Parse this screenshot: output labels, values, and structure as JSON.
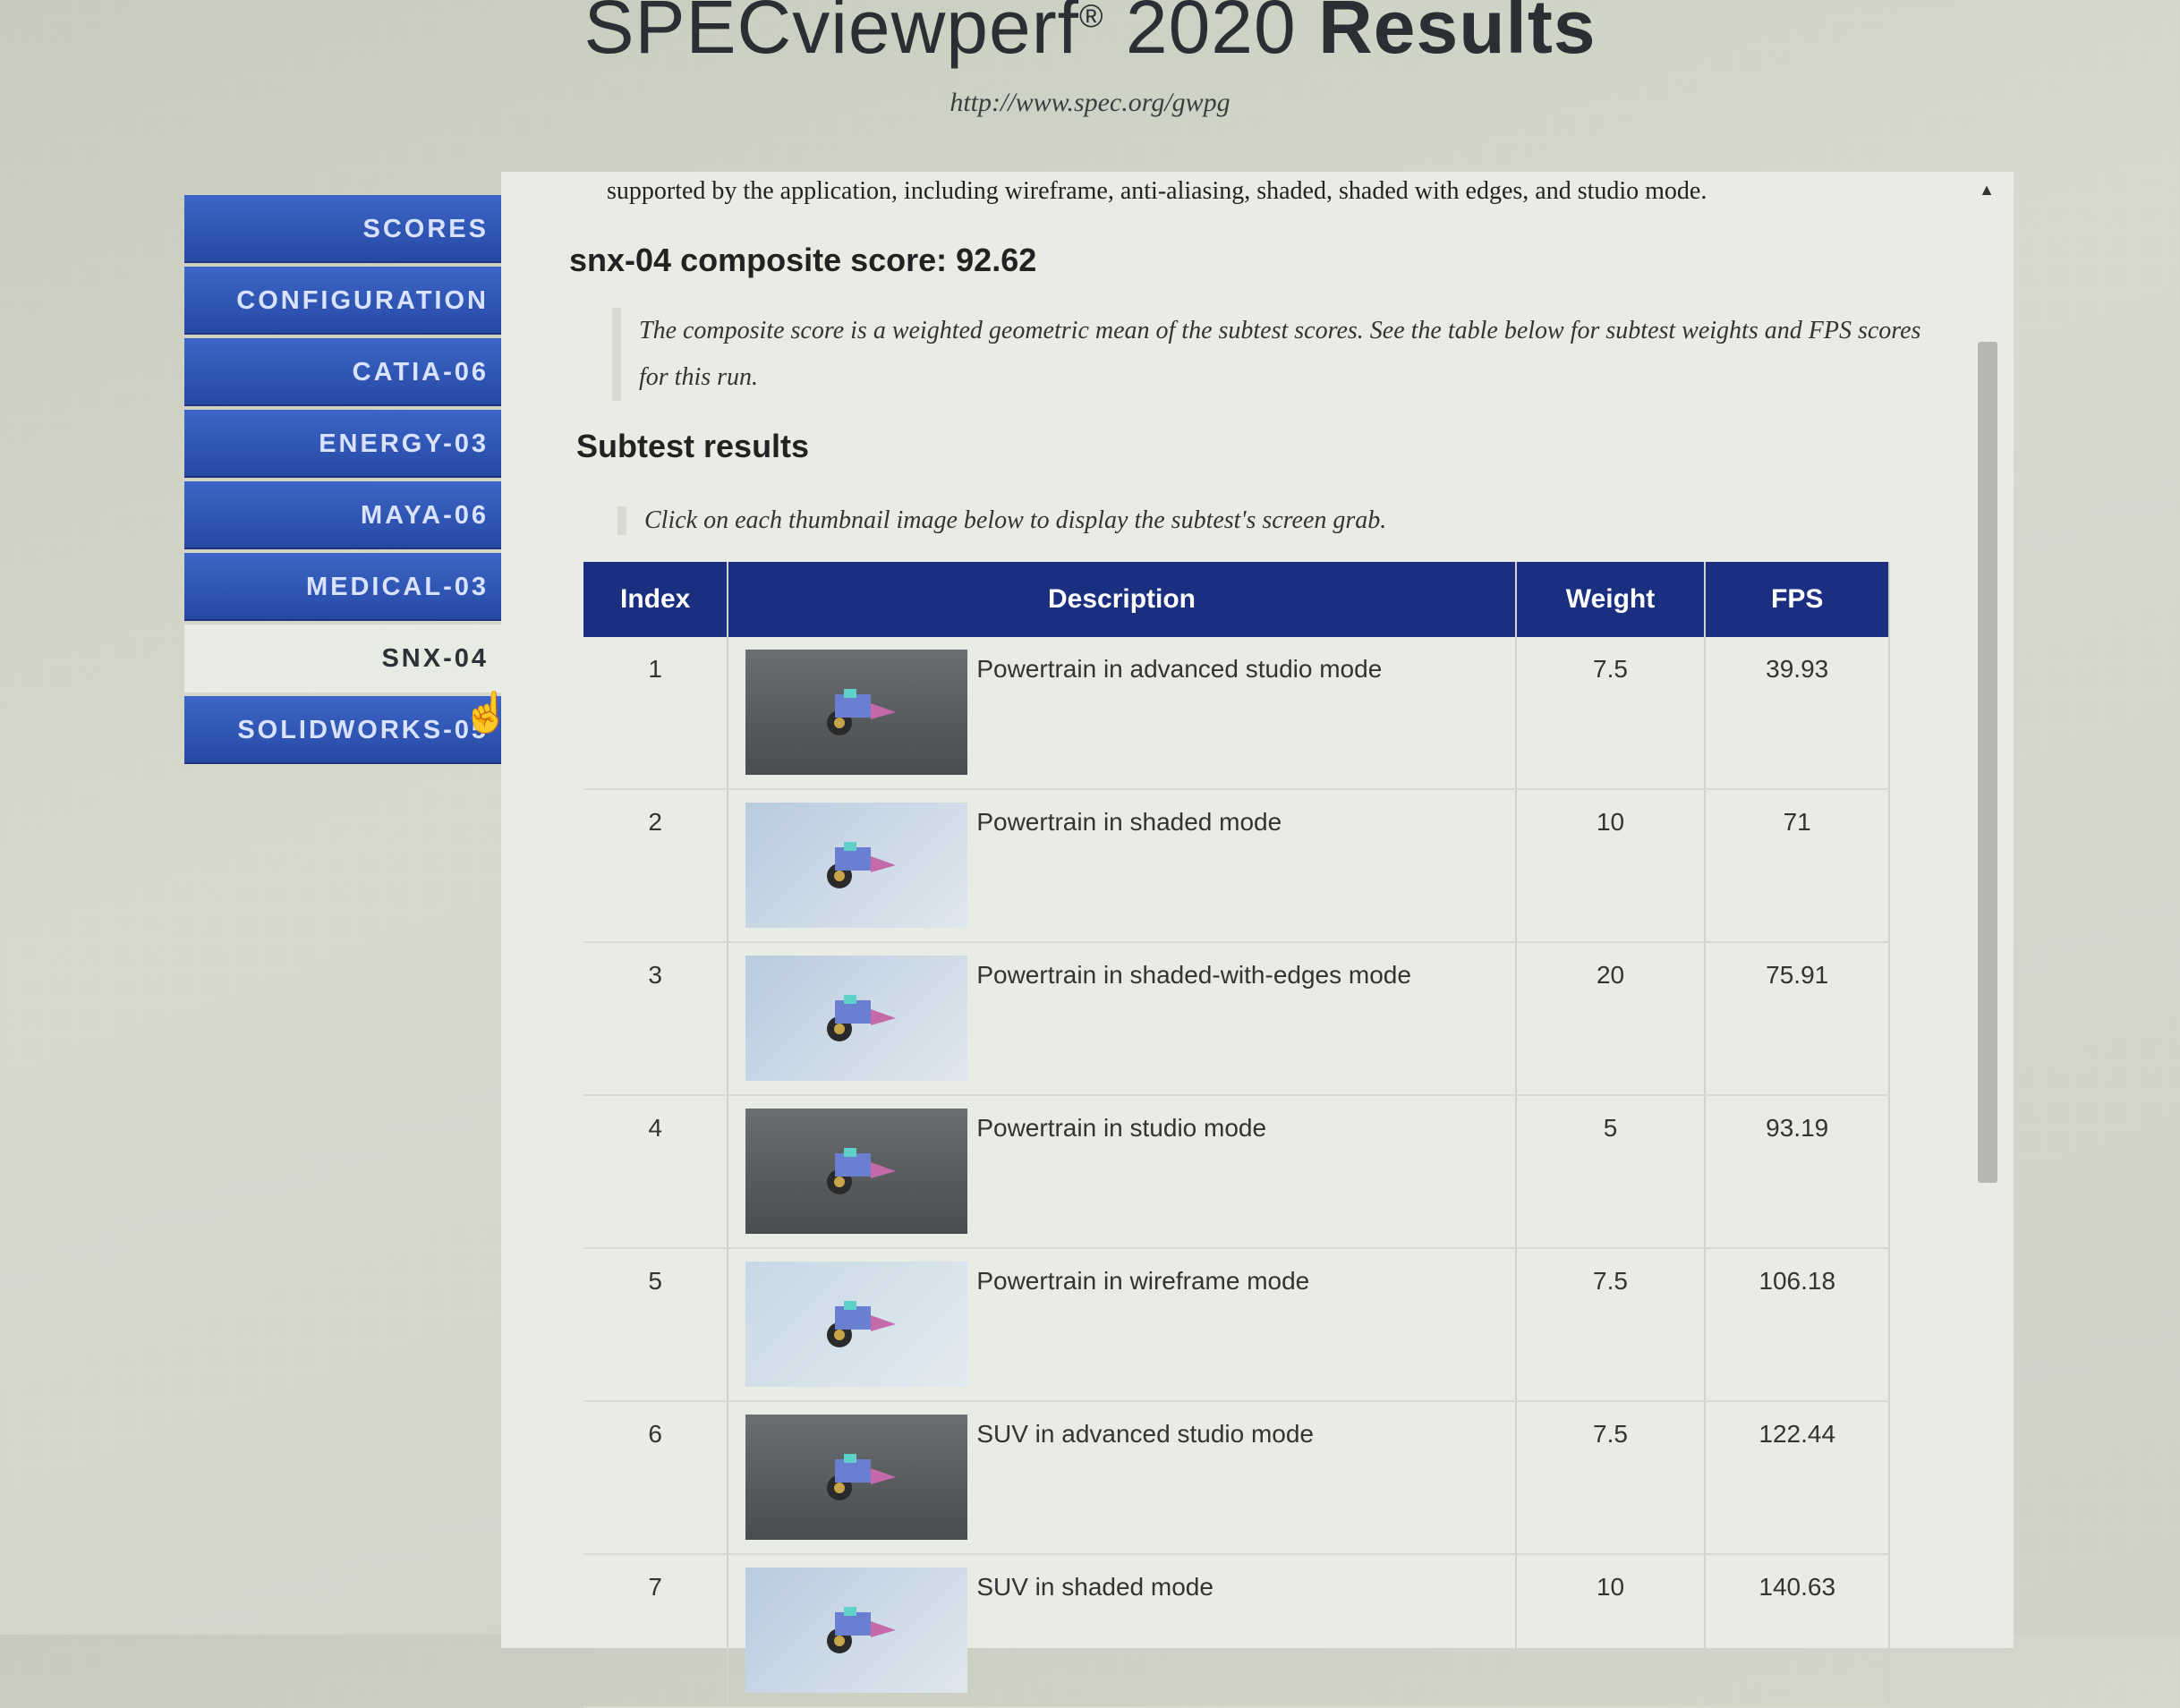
{
  "header": {
    "title_main": "SPECviewperf",
    "title_reg": "®",
    "title_year": "2020",
    "title_bold": "Results",
    "url": "http://www.spec.org/gwpg"
  },
  "sidebar": {
    "items": [
      {
        "label": "SCORES"
      },
      {
        "label": "CONFIGURATION"
      },
      {
        "label": "CATIA-06"
      },
      {
        "label": "ENERGY-03"
      },
      {
        "label": "MAYA-06"
      },
      {
        "label": "MEDICAL-03"
      },
      {
        "label": "SNX-04",
        "active": true
      },
      {
        "label": "SOLIDWORKS-05"
      }
    ]
  },
  "content": {
    "intro": "supported by the application, including wireframe, anti-aliasing, shaded, shaded with edges, and studio mode.",
    "composite_score": "snx-04 composite score: 92.62",
    "composite_note": "The composite score is a weighted geometric mean of the subtest scores. See the table below for subtest weights and FPS scores for this run.",
    "subtest_heading": "Subtest results",
    "thumb_note": "Click on each thumbnail image below to display the subtest's screen grab."
  },
  "table": {
    "headers": [
      "Index",
      "Description",
      "Weight",
      "FPS"
    ],
    "rows": [
      {
        "index": "1",
        "description": "Powertrain in advanced studio mode",
        "weight": "7.5",
        "fps": "39.93",
        "thumb": "dark"
      },
      {
        "index": "2",
        "description": "Powertrain in shaded mode",
        "weight": "10",
        "fps": "71",
        "thumb": "light"
      },
      {
        "index": "3",
        "description": "Powertrain in shaded-with-edges mode",
        "weight": "20",
        "fps": "75.91",
        "thumb": "light"
      },
      {
        "index": "4",
        "description": "Powertrain in studio mode",
        "weight": "5",
        "fps": "93.19",
        "thumb": "dark"
      },
      {
        "index": "5",
        "description": "Powertrain in wireframe mode",
        "weight": "7.5",
        "fps": "106.18",
        "thumb": "wire"
      },
      {
        "index": "6",
        "description": "SUV in advanced studio mode",
        "weight": "7.5",
        "fps": "122.44",
        "thumb": "dark"
      },
      {
        "index": "7",
        "description": "SUV in shaded mode",
        "weight": "10",
        "fps": "140.63",
        "thumb": "light"
      }
    ]
  },
  "colors": {
    "nav_blue": "#2d52b0",
    "table_header": "#1b2f80"
  }
}
